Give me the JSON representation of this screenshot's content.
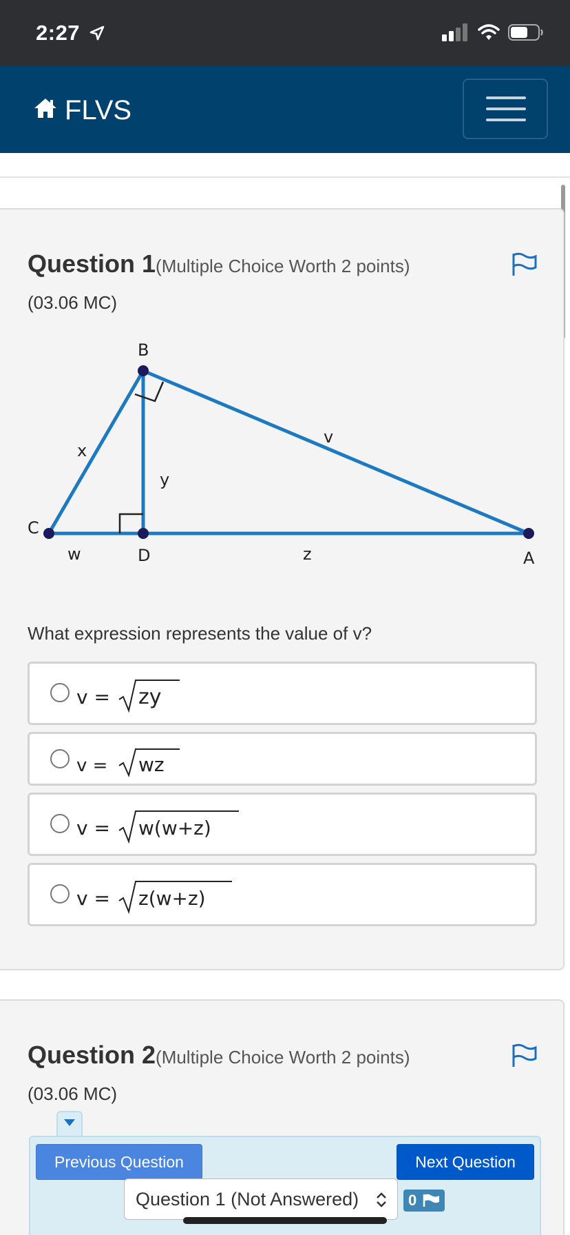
{
  "status_bar": {
    "time": "2:27"
  },
  "navbar": {
    "brand": "FLVS"
  },
  "questions": [
    {
      "title": "Question 1",
      "meta": "(Multiple Choice Worth 2 points)",
      "code": "(03.06 MC)",
      "prompt": "What expression represents the value of v?",
      "diagram_labels": {
        "B": "B",
        "C": "C",
        "D": "D",
        "A": "A",
        "x": "x",
        "y": "y",
        "v": "v",
        "w": "w",
        "z": "z"
      },
      "options": [
        {
          "lhs": "v =",
          "radicand": "zy"
        },
        {
          "lhs": "v =",
          "radicand": "wz"
        },
        {
          "lhs": "v =",
          "radicand": "w(w+z)"
        },
        {
          "lhs": "v =",
          "radicand": "z(w+z)"
        }
      ]
    },
    {
      "title": "Question 2",
      "meta": "(Multiple Choice Worth 2 points)",
      "code": "(03.06 MC)"
    }
  ],
  "bottom_nav": {
    "previous_label": "Previous Question",
    "next_label": "Next Question",
    "select_value": "Question 1 (Not Answered)",
    "flag_count": "0"
  },
  "colors": {
    "navbar": "#00416e",
    "diagram_line": "#1d7ac2",
    "flag": "#1a6fc0",
    "next_button": "#0059c8",
    "prev_button": "#4a86e0"
  }
}
